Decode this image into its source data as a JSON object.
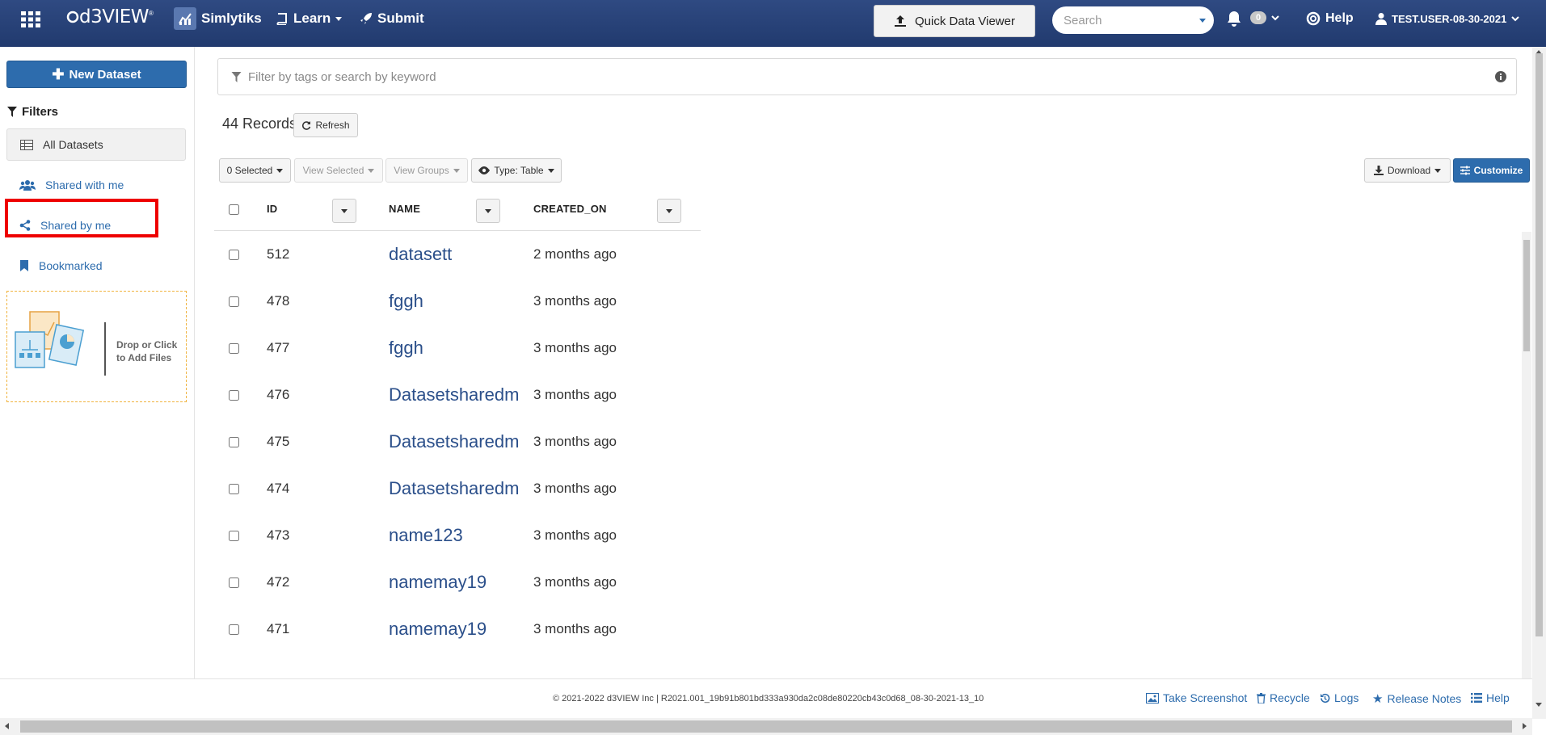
{
  "topnav": {
    "logo": "d3VIEW",
    "simlytiks": "Simlytiks",
    "learn": "Learn",
    "submit": "Submit",
    "quick_data_viewer": "Quick Data Viewer",
    "search_placeholder": "Search",
    "notification_count": "0",
    "help": "Help",
    "user": "TEST.USER-08-30-2021"
  },
  "sidebar": {
    "new_dataset": "New Dataset",
    "filters_title": "Filters",
    "items": [
      {
        "label": "All Datasets",
        "icon": "table-icon"
      },
      {
        "label": "Shared with me",
        "icon": "users-icon"
      },
      {
        "label": "Shared by me",
        "icon": "share-icon"
      },
      {
        "label": "Bookmarked",
        "icon": "bookmark-icon"
      }
    ],
    "dropzone_text": "Drop or Click to Add Files"
  },
  "main": {
    "filter_placeholder": "Filter by tags or search by keyword",
    "records_count": "44 Records",
    "refresh": "Refresh",
    "toolbar": {
      "selected": "0 Selected",
      "view_selected": "View Selected",
      "view_groups": "View Groups",
      "type": "Type: Table",
      "download": "Download",
      "customize": "Customize"
    },
    "columns": [
      "ID",
      "NAME",
      "CREATED_ON"
    ],
    "rows": [
      {
        "id": "512",
        "name": "datasett",
        "created_on": "2 months ago"
      },
      {
        "id": "478",
        "name": "fggh",
        "created_on": "3 months ago"
      },
      {
        "id": "477",
        "name": "fggh",
        "created_on": "3 months ago"
      },
      {
        "id": "476",
        "name": "Datasetsharedm",
        "created_on": "3 months ago"
      },
      {
        "id": "475",
        "name": "Datasetsharedm",
        "created_on": "3 months ago"
      },
      {
        "id": "474",
        "name": "Datasetsharedm",
        "created_on": "3 months ago"
      },
      {
        "id": "473",
        "name": "name123",
        "created_on": "3 months ago"
      },
      {
        "id": "472",
        "name": "namemay19",
        "created_on": "3 months ago"
      },
      {
        "id": "471",
        "name": "namemay19",
        "created_on": "3 months ago"
      }
    ]
  },
  "footer": {
    "copyright": "© 2021-2022 d3VIEW Inc | R2021.001_19b91b801bd333a930da2c08de80220cb43c0d68_08-30-2021-13_10",
    "take_screenshot": "Take Screenshot",
    "recycle": "Recycle",
    "logs": "Logs",
    "release_notes": "Release Notes",
    "help": "Help"
  },
  "colors": {
    "nav_bg": "#2a4478",
    "primary": "#2d6cad",
    "highlight": "#ee0000",
    "link": "#2b4f8a"
  }
}
